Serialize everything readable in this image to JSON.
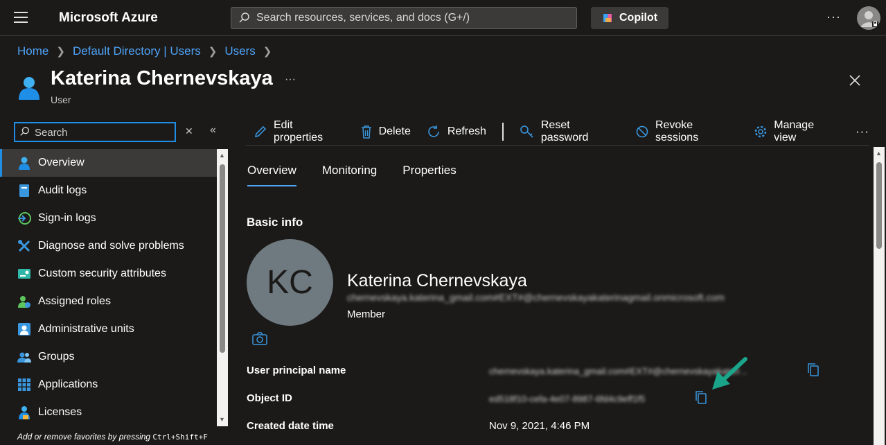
{
  "topbar": {
    "brand": "Microsoft Azure",
    "search_placeholder": "Search resources, services, and docs (G+/)",
    "copilot_label": "Copilot",
    "more_label": "···"
  },
  "breadcrumb": [
    "Home",
    "Default Directory | Users",
    "Users"
  ],
  "page": {
    "title": "Katerina Chernevskaya",
    "subtitle": "User",
    "more_label": "···"
  },
  "nav": {
    "search_placeholder": "Search",
    "clear_label": "✕",
    "collapse_label": "«",
    "items": [
      {
        "label": "Overview",
        "icon": "user-icon",
        "active": true
      },
      {
        "label": "Audit logs",
        "icon": "audit-log-icon"
      },
      {
        "label": "Sign-in logs",
        "icon": "sign-in-icon"
      },
      {
        "label": "Diagnose and solve problems",
        "icon": "wrench-icon"
      },
      {
        "label": "Custom security attributes",
        "icon": "security-attributes-icon"
      },
      {
        "label": "Assigned roles",
        "icon": "roles-icon"
      },
      {
        "label": "Administrative units",
        "icon": "admin-units-icon"
      },
      {
        "label": "Groups",
        "icon": "groups-icon"
      },
      {
        "label": "Applications",
        "icon": "applications-icon"
      },
      {
        "label": "Licenses",
        "icon": "licenses-icon"
      }
    ],
    "hint_prefix": "Add or remove favorites by pressing ",
    "hint_keys": "Ctrl+Shift+F"
  },
  "toolbar": {
    "edit": "Edit properties",
    "delete": "Delete",
    "refresh": "Refresh",
    "reset_password": "Reset password",
    "revoke_sessions": "Revoke sessions",
    "manage_view": "Manage view",
    "more": "···"
  },
  "tabs": [
    "Overview",
    "Monitoring",
    "Properties"
  ],
  "basic_info": {
    "section_title": "Basic info",
    "initials": "KC",
    "name": "Katerina Chernevskaya",
    "email": "chernevskaya.katerina_gmail.com#EXT#@chernevskayakaterinagmail.onmicrosoft.com",
    "user_type": "Member"
  },
  "properties": [
    {
      "label": "User principal name",
      "value": "chernevskaya.katerina_gmail.com#EXT#@chernevskayakateri ..",
      "blurred": true,
      "copy": true
    },
    {
      "label": "Object ID",
      "value": "ed518f10-cefa-4e07-8987-6fd4c9eff1f5",
      "blurred": true,
      "copy": true
    },
    {
      "label": "Created date time",
      "value": "Nov 9, 2021, 4:46 PM",
      "blurred": false,
      "copy": false
    }
  ],
  "colors": {
    "accent": "#1e8ee6",
    "link": "#4fa3f7",
    "arrow": "#1aa58a",
    "background": "#1b1a19"
  }
}
